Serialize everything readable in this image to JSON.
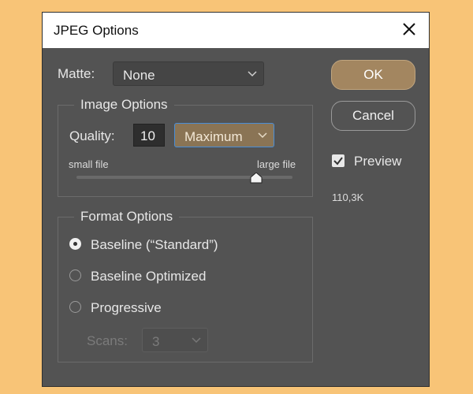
{
  "window": {
    "title": "JPEG Options"
  },
  "matte": {
    "label": "Matte:",
    "value": "None"
  },
  "image_options": {
    "legend": "Image Options",
    "quality_label": "Quality:",
    "quality_value": "10",
    "quality_preset": "Maximum",
    "slider_min_label": "small file",
    "slider_max_label": "large file",
    "slider_value": 10,
    "slider_min": 0,
    "slider_max": 12
  },
  "format_options": {
    "legend": "Format Options",
    "options": [
      "Baseline (“Standard”)",
      "Baseline Optimized",
      "Progressive"
    ],
    "selected_index": 0,
    "scans_label": "Scans:",
    "scans_value": "3"
  },
  "buttons": {
    "ok": "OK",
    "cancel": "Cancel"
  },
  "preview": {
    "label": "Preview",
    "checked": true
  },
  "file_size": "110,3K",
  "colors": {
    "accent": "#a38660",
    "dialog_bg": "#535353",
    "page_bg": "#F8C477"
  }
}
